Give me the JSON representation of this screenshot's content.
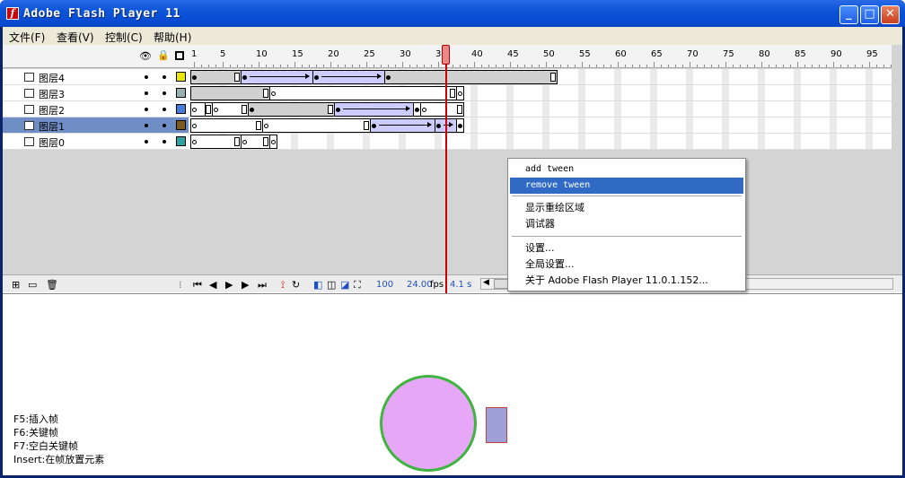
{
  "window": {
    "title": "Adobe Flash Player 11"
  },
  "menu": [
    {
      "label": "文件(F)"
    },
    {
      "label": "查看(V)"
    },
    {
      "label": "控制(C)"
    },
    {
      "label": "帮助(H)"
    }
  ],
  "ruler": {
    "labels": [
      "1",
      "5",
      "10",
      "15",
      "20",
      "25",
      "30",
      "35",
      "40",
      "45",
      "50",
      "55",
      "60",
      "65",
      "70",
      "75",
      "80",
      "85",
      "90",
      "95"
    ]
  },
  "layers": [
    {
      "name": "图层4",
      "color": "#e6e600"
    },
    {
      "name": "图层3",
      "color": "#9ab0b0"
    },
    {
      "name": "图层2",
      "color": "#4a7ad8"
    },
    {
      "name": "图层1",
      "color": "#7a5a20",
      "selected": true
    },
    {
      "name": "图层0",
      "color": "#30a0a0"
    }
  ],
  "controls": {
    "zoom": "100",
    "fps": "24.00",
    "fps_unit": "fps",
    "time": "4.1 s"
  },
  "context_menu": {
    "items": [
      {
        "label": "add tween"
      },
      {
        "label": "remove tween",
        "highlighted": true
      },
      {
        "label": "显示重绘区域"
      },
      {
        "label": "调试器"
      },
      {
        "label": "设置..."
      },
      {
        "label": "全局设置..."
      },
      {
        "label": "关于 Adobe Flash Player 11.0.1.152..."
      }
    ]
  },
  "hints": [
    {
      "text": "F5:插入帧"
    },
    {
      "text": "F6:关键帧"
    },
    {
      "text": "F7:空白关键帧"
    },
    {
      "text": "Insert:在帧放置元素"
    }
  ]
}
